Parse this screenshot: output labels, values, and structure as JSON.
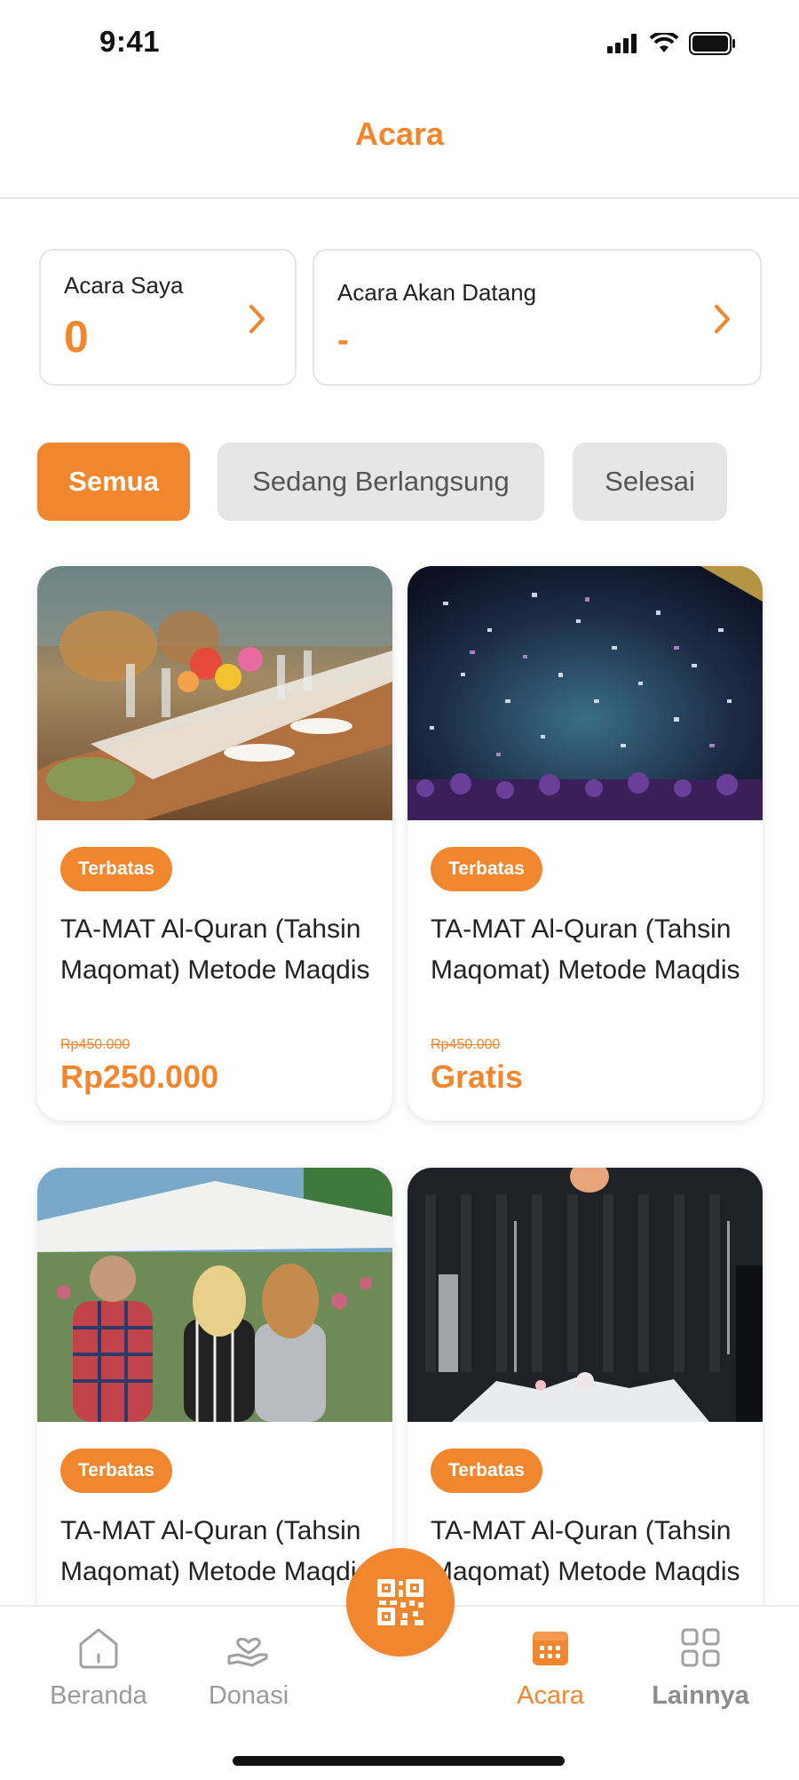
{
  "status_bar": {
    "time": "9:41"
  },
  "header": {
    "title": "Acara"
  },
  "summary": {
    "my_events": {
      "label": "Acara Saya",
      "value": "0"
    },
    "upcoming": {
      "label": "Acara Akan Datang",
      "value": "-"
    }
  },
  "tabs": [
    {
      "label": "Semua",
      "active": true
    },
    {
      "label": "Sedang Berlangsung",
      "active": false
    },
    {
      "label": "Selesai",
      "active": false
    }
  ],
  "events": [
    {
      "badge": "Terbatas",
      "title": "TA-MAT Al-Quran (Tahsin Maqomat) Metode Maqdis",
      "old_price": "Rp450.000",
      "price": "Rp250.000",
      "image": "banquet-table-flowers"
    },
    {
      "badge": "Terbatas",
      "title": "TA-MAT Al-Quran (Tahsin Maqomat) Metode Maqdis",
      "old_price": "Rp450.000",
      "price": "Gratis",
      "image": "concert-confetti"
    },
    {
      "badge": "Terbatas",
      "title": "TA-MAT Al-Quran (Tahsin Maqomat) Metode Maqdis",
      "image": "outdoor-festival-crowd"
    },
    {
      "badge": "Terbatas",
      "title": "TA-MAT Al-Quran (Tahsin Maqomat) Metode Maqdis",
      "image": "dark-stage-venue"
    }
  ],
  "nav": {
    "home": {
      "label": "Beranda",
      "icon": "home-icon"
    },
    "donation": {
      "label": "Donasi",
      "icon": "donation-icon"
    },
    "scan": {
      "icon": "qr-code-icon"
    },
    "events": {
      "label": "Acara",
      "icon": "calendar-icon"
    },
    "more": {
      "label": "Lainnya",
      "icon": "grid-icon"
    }
  },
  "colors": {
    "accent": "#f0862e",
    "tab_inactive": "#e6e6e6",
    "nav_inactive": "#9a9a9a"
  }
}
